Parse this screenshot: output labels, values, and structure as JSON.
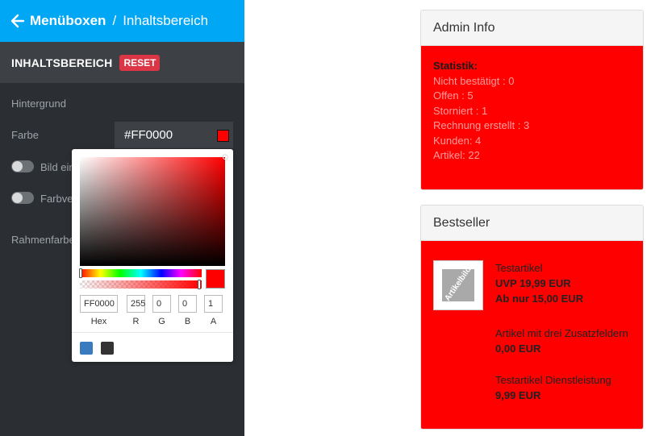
{
  "topbar": {
    "back_icon": "arrow-left-icon",
    "parent": "Menüboxen",
    "separator": "/",
    "current": "Inhaltsbereich"
  },
  "section": {
    "title": "INHALTSBEREICH",
    "reset_label": "RESET"
  },
  "settings": {
    "background_label": "Hintergrund",
    "color_label": "Farbe",
    "color_value": "#FF0000",
    "image_toggle_label": "Bild ein",
    "gradient_toggle_label": "Farbve",
    "border_color_label": "Rahmenfarbe"
  },
  "picker": {
    "hex": "FF0000",
    "r": "255",
    "g": "0",
    "b": "0",
    "a": "1",
    "labels": {
      "hex": "Hex",
      "r": "R",
      "g": "G",
      "b": "B",
      "a": "A"
    },
    "presets": [
      "#3a7bbf",
      "#333333"
    ]
  },
  "admin_info": {
    "title": "Admin Info",
    "stat_title": "Statistik:",
    "lines": [
      "Nicht bestätigt : 0",
      "Offen : 5",
      "Storniert : 1",
      "Rechnung erstellt : 3",
      "Kunden: 4",
      "Artikel: 22"
    ]
  },
  "bestseller": {
    "title": "Bestseller",
    "thumb_text": "Artikelbild",
    "products": [
      {
        "name": "Testartikel",
        "price1": "UVP 19,99 EUR",
        "price2": "Ab nur 15,00 EUR"
      },
      {
        "name": "Artikel mit drei Zusatzfeldern",
        "price1": "0,00 EUR"
      },
      {
        "name": "Testartikel Dienstleistung",
        "price1": "9,99 EUR"
      }
    ]
  },
  "colors": {
    "accent": "#00a7f5",
    "panel": "#2b2f33",
    "danger": "#dc3545",
    "box_bg": "#ff0000"
  }
}
